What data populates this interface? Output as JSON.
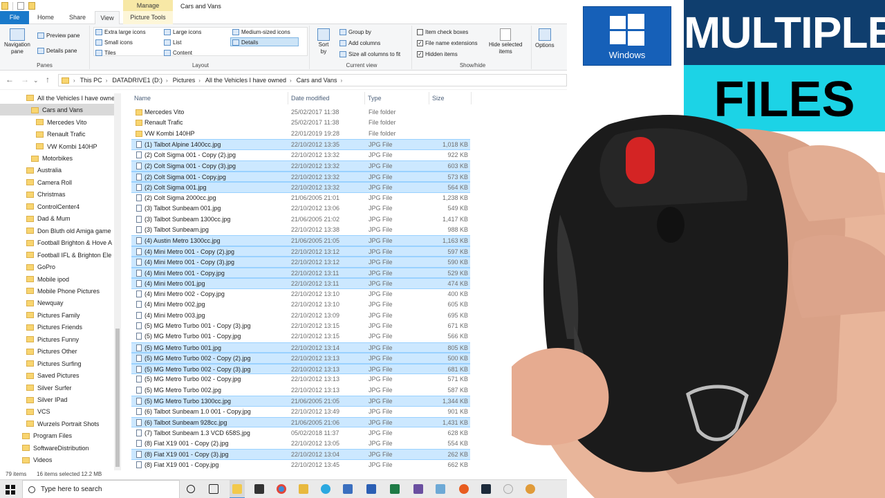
{
  "window": {
    "title": "Cars and Vans",
    "manage_tab": "Manage",
    "picture_tools_tab": "Picture Tools"
  },
  "tabs": {
    "file": "File",
    "home": "Home",
    "share": "Share",
    "view": "View"
  },
  "ribbon": {
    "panes": {
      "label": "Panes",
      "navigation_pane": "Navigation",
      "navigation_pane2": "pane",
      "preview_pane": "Preview pane",
      "details_pane": "Details pane"
    },
    "layout": {
      "label": "Layout",
      "extra_large": "Extra large icons",
      "large": "Large icons",
      "medium": "Medium-sized icons",
      "small": "Small icons",
      "list": "List",
      "details": "Details",
      "tiles": "Tiles",
      "content": "Content"
    },
    "current_view": {
      "label": "Current view",
      "sort": "Sort",
      "sort2": "by",
      "group_by": "Group by",
      "add_columns": "Add columns",
      "size_all": "Size all columns to fit"
    },
    "show_hide": {
      "label": "Show/hide",
      "item_check_boxes": "Item check boxes",
      "file_name_extensions": "File name extensions",
      "hidden_items": "Hidden items",
      "hide_selected": "Hide selected",
      "hide_selected2": "items"
    },
    "options": "Options"
  },
  "address": {
    "crumbs": [
      "This PC",
      "DATADRIVE1 (D:)",
      "Pictures",
      "All the Vehicles I have owned",
      "Cars and Vans"
    ]
  },
  "nav_items": [
    "All the Vehicles I have owne",
    "Cars and Vans",
    "Mercedes Vito",
    "Renault Trafic",
    "VW Kombi 140HP",
    "Motorbikes",
    "Australia",
    "Camera Roll",
    "Christmas",
    "ControlCenter4",
    "Dad & Mum",
    "Don Bluth old Amiga game",
    "Football Brighton & Hove A",
    "Football IFL & Brighton Ele",
    "GoPro",
    "Mobile ipod",
    "Mobile Phone Pictures",
    "Newquay",
    "Pictures Family",
    "Pictures Friends",
    "Pictures Funny",
    "Pictures Other",
    "Pictures Surfing",
    "Saved Pictures",
    "Silver Surfer",
    "Silver IPad",
    "VCS",
    "Wurzels Portrait Shots",
    "Program Files",
    "SoftwareDistribution",
    "Videos"
  ],
  "columns": {
    "name": "Name",
    "date": "Date modified",
    "type": "Type",
    "size": "Size"
  },
  "files": [
    {
      "name": "Mercedes Vito",
      "date": "25/02/2017 11:38",
      "type": "File folder",
      "size": "",
      "selected": false,
      "folder": true
    },
    {
      "name": "Renault Trafic",
      "date": "25/02/2017 11:38",
      "type": "File folder",
      "size": "",
      "selected": false,
      "folder": true
    },
    {
      "name": "VW Kombi 140HP",
      "date": "22/01/2019 19:28",
      "type": "File folder",
      "size": "",
      "selected": false,
      "folder": true
    },
    {
      "name": "(1) Talbot Alpine 1400cc.jpg",
      "date": "22/10/2012 13:35",
      "type": "JPG File",
      "size": "1,018 KB",
      "selected": true
    },
    {
      "name": "(2) Colt Sigma 001 - Copy (2).jpg",
      "date": "22/10/2012 13:32",
      "type": "JPG File",
      "size": "922 KB",
      "selected": false
    },
    {
      "name": "(2) Colt Sigma 001 - Copy (3).jpg",
      "date": "22/10/2012 13:32",
      "type": "JPG File",
      "size": "603 KB",
      "selected": true
    },
    {
      "name": "(2) Colt Sigma 001 - Copy.jpg",
      "date": "22/10/2012 13:32",
      "type": "JPG File",
      "size": "573 KB",
      "selected": true
    },
    {
      "name": "(2) Colt Sigma 001.jpg",
      "date": "22/10/2012 13:32",
      "type": "JPG File",
      "size": "564 KB",
      "selected": true
    },
    {
      "name": "(2) Colt Sigma 2000cc.jpg",
      "date": "21/06/2005 21:01",
      "type": "JPG File",
      "size": "1,238 KB",
      "selected": false
    },
    {
      "name": "(3) Talbot Sunbeam 001.jpg",
      "date": "22/10/2012 13:06",
      "type": "JPG File",
      "size": "549 KB",
      "selected": false
    },
    {
      "name": "(3) Talbot Sunbeam 1300cc.jpg",
      "date": "21/06/2005 21:02",
      "type": "JPG File",
      "size": "1,417 KB",
      "selected": false
    },
    {
      "name": "(3) Talbot Sunbeam.jpg",
      "date": "22/10/2012 13:38",
      "type": "JPG File",
      "size": "988 KB",
      "selected": false
    },
    {
      "name": "(4) Austin Metro 1300cc.jpg",
      "date": "21/06/2005 21:05",
      "type": "JPG File",
      "size": "1,163 KB",
      "selected": true
    },
    {
      "name": "(4) Mini Metro 001 - Copy (2).jpg",
      "date": "22/10/2012 13:12",
      "type": "JPG File",
      "size": "597 KB",
      "selected": true
    },
    {
      "name": "(4) Mini Metro 001 - Copy (3).jpg",
      "date": "22/10/2012 13:12",
      "type": "JPG File",
      "size": "590 KB",
      "selected": true
    },
    {
      "name": "(4) Mini Metro 001 - Copy.jpg",
      "date": "22/10/2012 13:11",
      "type": "JPG File",
      "size": "529 KB",
      "selected": true
    },
    {
      "name": "(4) Mini Metro 001.jpg",
      "date": "22/10/2012 13:11",
      "type": "JPG File",
      "size": "474 KB",
      "selected": true
    },
    {
      "name": "(4) Mini Metro 002 - Copy.jpg",
      "date": "22/10/2012 13:10",
      "type": "JPG File",
      "size": "400 KB",
      "selected": false
    },
    {
      "name": "(4) Mini Metro 002.jpg",
      "date": "22/10/2012 13:10",
      "type": "JPG File",
      "size": "605 KB",
      "selected": false
    },
    {
      "name": "(4) Mini Metro 003.jpg",
      "date": "22/10/2012 13:09",
      "type": "JPG File",
      "size": "695 KB",
      "selected": false
    },
    {
      "name": "(5) MG Metro Turbo 001 - Copy (3).jpg",
      "date": "22/10/2012 13:15",
      "type": "JPG File",
      "size": "671 KB",
      "selected": false
    },
    {
      "name": "(5) MG Metro Turbo 001 - Copy.jpg",
      "date": "22/10/2012 13:15",
      "type": "JPG File",
      "size": "566 KB",
      "selected": false
    },
    {
      "name": "(5) MG Metro Turbo 001.jpg",
      "date": "22/10/2012 13:14",
      "type": "JPG File",
      "size": "805 KB",
      "selected": true
    },
    {
      "name": "(5) MG Metro Turbo 002 - Copy (2).jpg",
      "date": "22/10/2012 13:13",
      "type": "JPG File",
      "size": "500 KB",
      "selected": true
    },
    {
      "name": "(5) MG Metro Turbo 002 - Copy (3).jpg",
      "date": "22/10/2012 13:13",
      "type": "JPG File",
      "size": "681 KB",
      "selected": true
    },
    {
      "name": "(5) MG Metro Turbo 002 - Copy.jpg",
      "date": "22/10/2012 13:13",
      "type": "JPG File",
      "size": "571 KB",
      "selected": false
    },
    {
      "name": "(5) MG Metro Turbo 002.jpg",
      "date": "22/10/2012 13:13",
      "type": "JPG File",
      "size": "587 KB",
      "selected": false
    },
    {
      "name": "(5) MG Metro Turbo 1300cc.jpg",
      "date": "21/06/2005 21:05",
      "type": "JPG File",
      "size": "1,344 KB",
      "selected": true
    },
    {
      "name": "(6) Talbot Sunbeam 1.0 001 - Copy.jpg",
      "date": "22/10/2012 13:49",
      "type": "JPG File",
      "size": "901 KB",
      "selected": false
    },
    {
      "name": "(6) Talbot Sunbeam 928cc.jpg",
      "date": "21/06/2005 21:06",
      "type": "JPG File",
      "size": "1,431 KB",
      "selected": true
    },
    {
      "name": "(7) Talbot Sunbeam 1.3 VCD 658S.jpg",
      "date": "05/02/2018 11:37",
      "type": "JPG File",
      "size": "628 KB",
      "selected": false
    },
    {
      "name": "(8) Fiat X19 001 - Copy (2).jpg",
      "date": "22/10/2012 13:05",
      "type": "JPG File",
      "size": "554 KB",
      "selected": false
    },
    {
      "name": "(8) Fiat X19 001 - Copy (3).jpg",
      "date": "22/10/2012 13:04",
      "type": "JPG File",
      "size": "262 KB",
      "selected": true
    },
    {
      "name": "(8) Fiat X19 001 - Copy.jpg",
      "date": "22/10/2012 13:45",
      "type": "JPG File",
      "size": "662 KB",
      "selected": false
    }
  ],
  "status": {
    "items": "79 items",
    "selected": "16 items selected  12.2 MB"
  },
  "taskbar": {
    "search_placeholder": "Type here to search"
  },
  "overlay": {
    "windows_logo_text": "Windows",
    "banner_line1": "MULTIPLE",
    "banner_line2": "FILES",
    "banner_top_color": "#0f3e6e",
    "banner_bottom_color": "#1cd3e6"
  },
  "colors": {
    "selection": "#cce8ff",
    "accent": "#1979ca",
    "folder": "#f8d570"
  }
}
